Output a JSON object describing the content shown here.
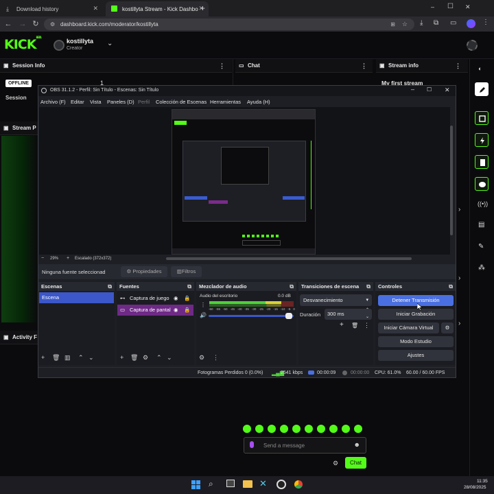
{
  "browser": {
    "tabs": [
      {
        "title": "Download history"
      },
      {
        "title": "kostillyta Stream - Kick Dashbo"
      }
    ],
    "new_tab": "+",
    "url": "dashboard.kick.com/moderator/kostillyta",
    "window_controls": [
      "–",
      "☐",
      "✕"
    ]
  },
  "kick": {
    "logo": "KICK",
    "logo_sup": "BETA",
    "user": {
      "name": "kostillyta",
      "role": "Creator"
    },
    "panels": {
      "session_info": "Session Info",
      "chat": "Chat",
      "stream_info": "Stream info",
      "stream_preview": "Stream P",
      "activity": "Activity F"
    },
    "offline_badge": "OFFLINE",
    "session_label": "Session",
    "session_value": "1",
    "stream_title": "My first stream",
    "chat_placeholder": "Send a message",
    "chat_button": "Chat"
  },
  "obs": {
    "title": "OBS 31.1.2 - Perfil: Sin Título - Escenas: Sin Título",
    "menu": [
      "Archivo (F)",
      "Editar",
      "Vista",
      "Paneles (D)",
      "Perfil",
      "Colección de Escenas",
      "Herramientas",
      "Ayuda (H)"
    ],
    "zoom": "29%",
    "scale": "Escalado (372x372)",
    "no_source": "Ninguna fuente seleccionad",
    "properties_btn": "Propiedades",
    "filters_btn": "Filtros",
    "docks": {
      "scenes": "Escenas",
      "sources": "Fuentes",
      "mixer": "Mezclador de audio",
      "transitions": "Transiciones de escena",
      "controls": "Controles"
    },
    "scenes": [
      "Escena"
    ],
    "sources": [
      "Captura de juego",
      "Captura de pantal"
    ],
    "mixer_channel": "Audio del escritorio",
    "mixer_db": "0.0 dB",
    "meter_ticks": [
      "-60",
      "-55",
      "-50",
      "-45",
      "-40",
      "-35",
      "-30",
      "-25",
      "-20",
      "-15",
      "-10",
      "-5",
      "0"
    ],
    "transition": "Desvanecimiento",
    "duration_label": "Duración",
    "duration_value": "300 ms",
    "controls": [
      "Detener Transmisión",
      "Iniciar Grabación",
      "Iniciar Cámara Virtual",
      "Modo Estudio",
      "Ajustes"
    ],
    "status": {
      "dropped": "Fotogramas Perdidos 0 (0.0%)",
      "kbps": "2541 kbps",
      "stream_time": "00:00:09",
      "rec_time": "00:00:00",
      "cpu": "CPU: 61.0%",
      "fps": "60.00 / 60.00 FPS"
    },
    "accent": "#4a6fe0"
  },
  "taskbar": {
    "time": "11:35",
    "date": "28/08/2025"
  },
  "colors": {
    "kick_green": "#53fc18"
  }
}
